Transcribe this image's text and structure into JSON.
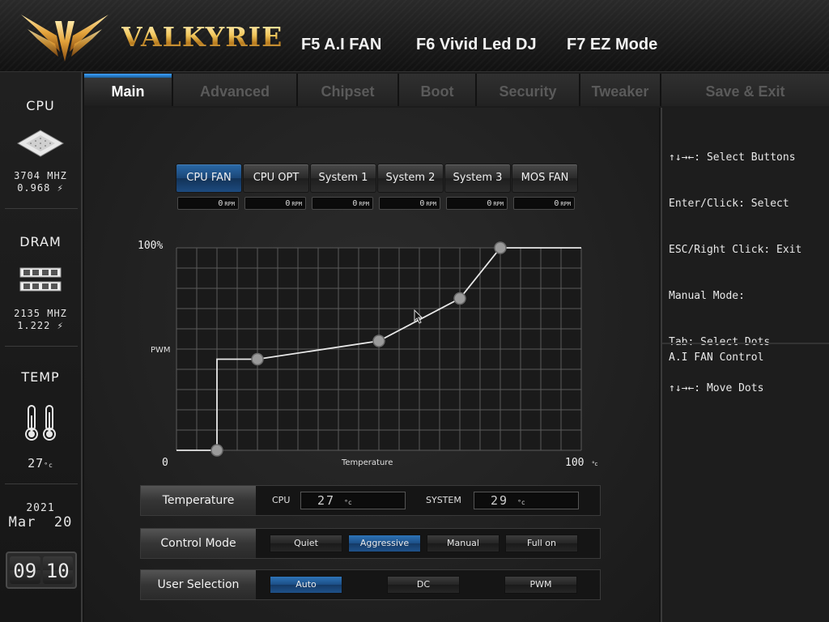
{
  "header": {
    "brand": "VALKYRIE",
    "fkeys": [
      "F5 A.I FAN",
      "F6 Vivid Led DJ",
      "F7 EZ Mode"
    ]
  },
  "sidebar": {
    "cpu": {
      "title": "CPU",
      "freq": "3704 MHZ",
      "volt": "0.968"
    },
    "dram": {
      "title": "DRAM",
      "freq": "2135 MHZ",
      "volt": "1.222"
    },
    "temp": {
      "title": "TEMP",
      "value": "27",
      "unit": "°c"
    },
    "date": {
      "year": "2021",
      "month": "Mar",
      "day": "20"
    },
    "clock": {
      "hh": "09",
      "mm": "10"
    }
  },
  "tabs": [
    "Main",
    "Advanced",
    "Chipset",
    "Boot",
    "Security",
    "Tweaker",
    "Save & Exit"
  ],
  "active_tab": "Main",
  "fans": [
    {
      "label": "CPU FAN",
      "rpm": "0"
    },
    {
      "label": "CPU OPT",
      "rpm": "0"
    },
    {
      "label": "System 1",
      "rpm": "0"
    },
    {
      "label": "System 2",
      "rpm": "0"
    },
    {
      "label": "System 3",
      "rpm": "0"
    },
    {
      "label": "MOS FAN",
      "rpm": "0"
    }
  ],
  "rpm_unit": "RPM",
  "active_fan": "CPU FAN",
  "chart": {
    "y_top_label": "100%",
    "y_mid_label": "PWM",
    "x_min_label": "0",
    "x_max_label": "100",
    "x_max_unit": "°c",
    "x_label": "Temperature"
  },
  "chart_data": {
    "type": "line",
    "x": [
      0,
      10,
      10,
      20,
      50,
      70,
      80,
      100
    ],
    "y": [
      0,
      0,
      45,
      45,
      54,
      75,
      100,
      100
    ],
    "control_points": [
      {
        "x": 10,
        "y": 0
      },
      {
        "x": 20,
        "y": 45
      },
      {
        "x": 50,
        "y": 54
      },
      {
        "x": 70,
        "y": 75
      },
      {
        "x": 80,
        "y": 100
      }
    ],
    "xlim": [
      0,
      100
    ],
    "ylim": [
      0,
      100
    ],
    "grid": true
  },
  "temperature_row": {
    "label": "Temperature",
    "cpu_label": "CPU",
    "cpu_value": "27",
    "system_label": "SYSTEM",
    "system_value": "29",
    "unit": "°c"
  },
  "control_mode": {
    "label": "Control Mode",
    "options": [
      "Quiet",
      "Aggressive",
      "Manual",
      "Full on"
    ],
    "selected": "Aggressive"
  },
  "user_selection": {
    "label": "User Selection",
    "options": [
      "Auto",
      "DC",
      "PWM"
    ],
    "selected": "Auto"
  },
  "help": {
    "lines": [
      "↑↓→←: Select Buttons",
      "Enter/Click: Select",
      "ESC/Right Click: Exit",
      "Manual Mode:",
      "Tab: Select Dots",
      "↑↓→←: Move Dots"
    ]
  },
  "description": "A.I FAN Control",
  "colors": {
    "accent": "#2f8fb0",
    "active_blue": "#1c4e86",
    "gold": "#f2c75c"
  }
}
